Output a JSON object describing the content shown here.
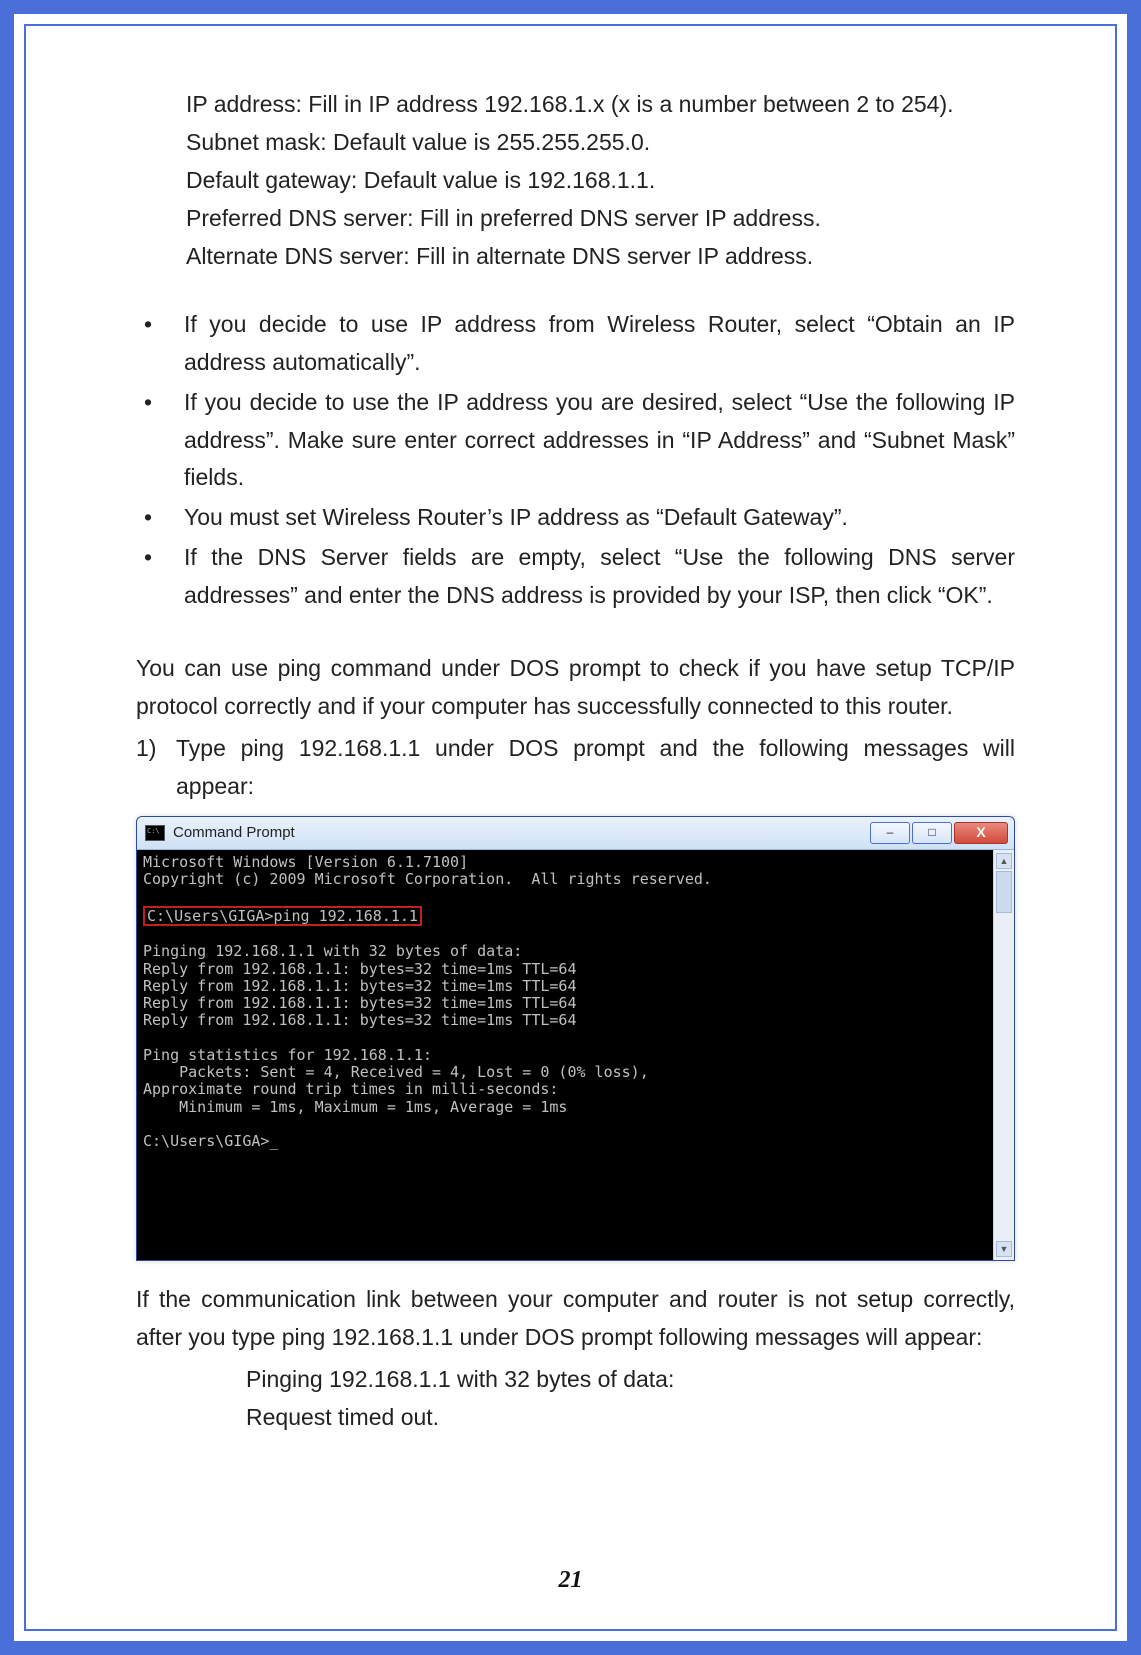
{
  "settings": {
    "ip": "IP address: Fill in IP address 192.168.1.x (x is a number between 2 to 254).",
    "subnet": "Subnet mask: Default value is 255.255.255.0.",
    "gateway": "Default gateway: Default value is 192.168.1.1.",
    "dns1": "Preferred DNS server: Fill in preferred DNS server IP address.",
    "dns2": "Alternate DNS server: Fill in alternate DNS server IP address."
  },
  "bullets": [
    "If you decide to use IP address from Wireless Router, select “Obtain an IP address automatically”.",
    "If you decide to use the IP address you are desired, select “Use the following IP address”. Make sure enter correct addresses in “IP Address” and “Subnet Mask” fields.",
    "You must set Wireless Router’s IP address as “Default Gateway”.",
    "If the DNS Server fields are empty, select “Use the following DNS server addresses” and enter the DNS address is provided by your ISP, then click “OK”."
  ],
  "bullet_marker": "•",
  "ping_intro": "You can use ping command under DOS prompt to check if you have setup TCP/IP protocol correctly and if your computer has successfully connected to this router.",
  "step1_marker": "1)",
  "step1_text": "Type ping 192.168.1.1 under DOS prompt and the following messages will appear:",
  "cmd": {
    "title": "Command Prompt",
    "minimize": "–",
    "maximize": "□",
    "close": "X",
    "line_version": "Microsoft Windows [Version 6.1.7100]",
    "line_copyright": "Copyright (c) 2009 Microsoft Corporation.  All rights reserved.",
    "prompt1_pre": "C:\\Users\\GIGA>",
    "prompt1_cmd": "ping 192.168.1.1",
    "pinging": "Pinging 192.168.1.1 with 32 bytes of data:",
    "reply": "Reply from 192.168.1.1: bytes=32 time=1ms TTL=64",
    "stats_header": "Ping statistics for 192.168.1.1:",
    "stats_packets": "    Packets: Sent = 4, Received = 4, Lost = 0 (0% loss),",
    "stats_approx": "Approximate round trip times in milli-seconds:",
    "stats_times": "    Minimum = 1ms, Maximum = 1ms, Average = 1ms",
    "prompt2": "C:\\Users\\GIGA>_",
    "scroll_up": "▲",
    "scroll_down": "▼"
  },
  "fail_intro": "If the communication link between your computer and router is not setup correctly, after you type ping 192.168.1.1 under DOS prompt following messages will appear:",
  "fail_line1": "Pinging 192.168.1.1 with 32 bytes of data:",
  "fail_line2": "Request timed out.",
  "page_number": "21"
}
